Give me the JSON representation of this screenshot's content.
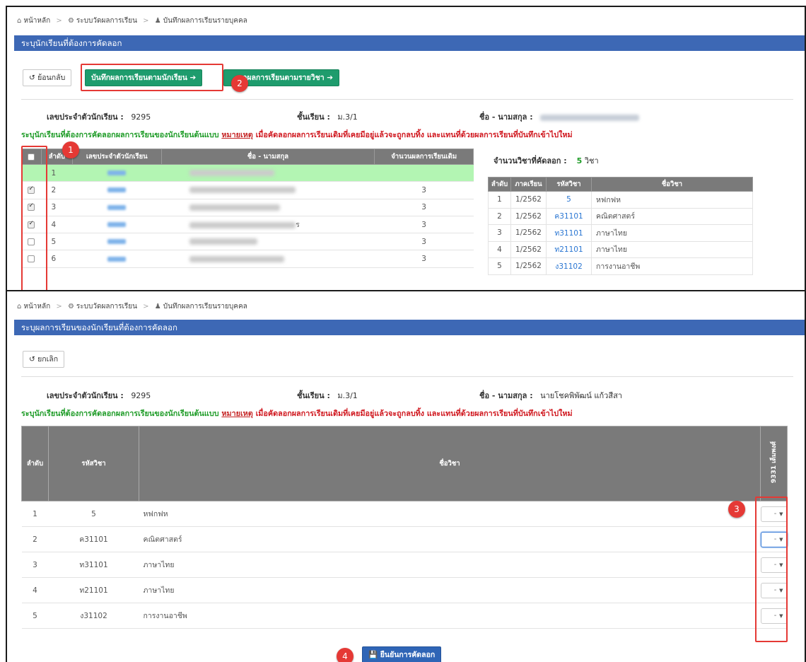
{
  "top": {
    "breadcrumb": {
      "home": "หน้าหลัก",
      "section": "ระบบวัดผลการเรียน",
      "page": "บันทึกผลการเรียนรายบุคคล"
    },
    "title": "ระบุนักเรียนที่ต้องการคัดลอก",
    "back_label": "ย้อนกลับ",
    "by_student_label": "บันทึกผลการเรียนตามนักเรียน",
    "by_subject_label": "กผลการเรียนตามรายวิชา",
    "student_id_label": "เลขประจำตัวนักเรียน :",
    "student_id": "9295",
    "class_label": "ชั้นเรียน :",
    "class_value": "ม.3/1",
    "name_label": "ชื่อ - นามสกุล :",
    "note_green": "ระบุนักเรียนที่ต้องการคัดลอกผลการเรียนของนักเรียนต้นแบบ",
    "note_underline": "หมายเหตุ",
    "note_red": "เมื่อคัดลอกผลการเรียนเดิมที่เคยมีอยู่แล้วจะถูกลบทิ้ง และแทนที่ด้วยผลการเรียนที่บันทึกเข้าไปใหม่",
    "students_table": {
      "headers": [
        "ลำดับ",
        "เลขประจำตัวนักเรียน",
        "ชื่อ - นามสกุล",
        "จำนวนผลการเรียนเดิม"
      ],
      "rows": [
        {
          "no": "1",
          "checked": false,
          "count": "",
          "highlight": true
        },
        {
          "no": "2",
          "checked": true,
          "count": "3"
        },
        {
          "no": "3",
          "checked": true,
          "count": "3"
        },
        {
          "no": "4",
          "checked": true,
          "count": "3"
        },
        {
          "no": "5",
          "checked": false,
          "count": "3"
        },
        {
          "no": "6",
          "checked": false,
          "count": "3"
        }
      ],
      "partial_name_suffix": "ร"
    },
    "copy_count_label": "จำนวนวิชาที่คัดลอก :",
    "copy_count_value": "5",
    "copy_count_unit": "วิชา",
    "subjects_table": {
      "headers": [
        "ลำดับ",
        "ภาคเรียน",
        "รหัสวิชา",
        "ชื่อวิชา"
      ],
      "rows": [
        {
          "no": "1",
          "term": "1/2562",
          "code": "5",
          "name": "หฟกฟห"
        },
        {
          "no": "2",
          "term": "1/2562",
          "code": "ค31101",
          "name": "คณิตศาสตร์"
        },
        {
          "no": "3",
          "term": "1/2562",
          "code": "ท31101",
          "name": "ภาษาไทย"
        },
        {
          "no": "4",
          "term": "1/2562",
          "code": "ท21101",
          "name": "ภาษาไทย"
        },
        {
          "no": "5",
          "term": "1/2562",
          "code": "ง31102",
          "name": "การงานอาชีพ"
        }
      ]
    }
  },
  "bottom": {
    "breadcrumb": {
      "home": "หน้าหลัก",
      "section": "ระบบวัดผลการเรียน",
      "page": "บันทึกผลการเรียนรายบุคคล"
    },
    "title": "ระบุผลการเรียนของนักเรียนที่ต้องการคัดลอก",
    "cancel_label": "ยกเลิก",
    "student_id_label": "เลขประจำตัวนักเรียน :",
    "student_id": "9295",
    "class_label": "ชั้นเรียน :",
    "class_value": "ม.3/1",
    "name_label": "ชื่อ - นามสกุล :",
    "name_value": "นายโชคพิพัฒน์ แก้วสีสา",
    "note_green": "ระบุนักเรียนที่ต้องการคัดลอกผลการเรียนของนักเรียนต้นแบบ",
    "note_underline": "หมายเหตุ",
    "note_red": "เมื่อคัดลอกผลการเรียนเดิมที่เคยมีอยู่แล้วจะถูกลบทิ้ง และแทนที่ด้วยผลการเรียนที่บันทึกเข้าไปใหม่",
    "grades_table": {
      "headers": [
        "ลำดับ",
        "รหัสวิชา",
        "ชื่อวิชา",
        "9331 เต็มพงศ์"
      ],
      "rows": [
        {
          "no": "1",
          "code": "5",
          "name": "หฟกฟห",
          "grade": "-"
        },
        {
          "no": "2",
          "code": "ค31101",
          "name": "คณิตศาสตร์",
          "grade": "-"
        },
        {
          "no": "3",
          "code": "ท31101",
          "name": "ภาษาไทย",
          "grade": "-"
        },
        {
          "no": "4",
          "code": "ท21101",
          "name": "ภาษาไทย",
          "grade": "-"
        },
        {
          "no": "5",
          "code": "ง31102",
          "name": "การงานอาชีพ",
          "grade": "-"
        }
      ]
    },
    "confirm_label": "ยืนยันการคัดลอก"
  },
  "callouts": [
    "1",
    "2",
    "3",
    "4"
  ],
  "colors": {
    "title_bar": "#3d68b5",
    "green_button": "#1e9c6d",
    "blue_button": "#2f65b6",
    "callout": "#e53935",
    "highlight_row": "#b3f5b3",
    "table_header": "#7a7a7a"
  }
}
